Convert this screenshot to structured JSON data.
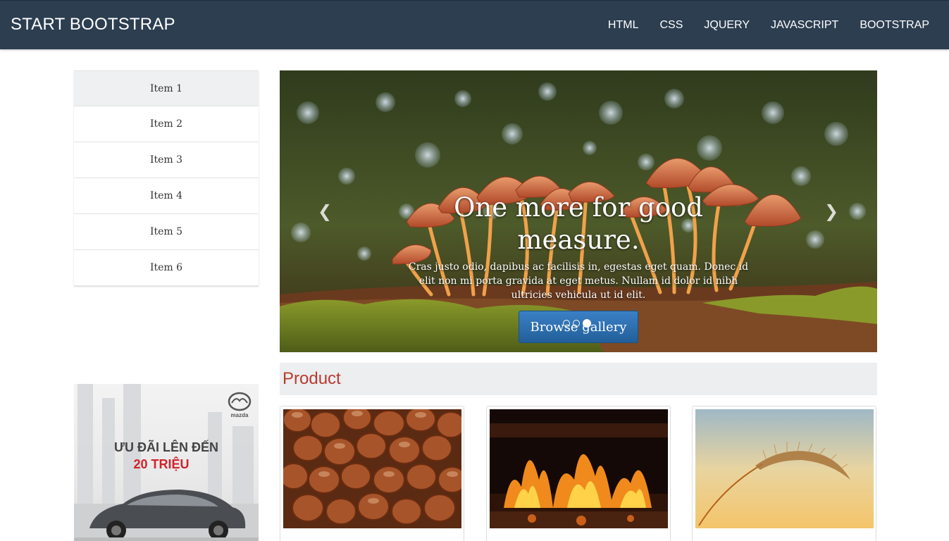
{
  "navbar": {
    "brand": "START BOOTSTRAP",
    "links": [
      "HTML",
      "CSS",
      "JQUERY",
      "JAVASCRIPT",
      "BOOTSTRAP"
    ]
  },
  "sidebar": {
    "items": [
      {
        "label": "Item 1",
        "active": true
      },
      {
        "label": "Item 2"
      },
      {
        "label": "Item 3"
      },
      {
        "label": "Item 4"
      },
      {
        "label": "Item 5"
      },
      {
        "label": "Item 6"
      }
    ]
  },
  "carousel": {
    "heading": "One more for good measure.",
    "text": "Cras justo odio, dapibus ac facilisis in, egestas eget quam. Donec id elit non mi porta gravida at eget metus. Nullam id dolor id nibh ultricies vehicula ut id elit.",
    "button_label": "Browse gallery",
    "prev_icon": "chevron-left-icon",
    "next_icon": "chevron-right-icon",
    "slide_count": 3,
    "active_slide": 3
  },
  "product": {
    "title": "Product",
    "cards": [
      {
        "image": "hazelnuts-photo"
      },
      {
        "image": "fireplace-photo"
      },
      {
        "image": "grass-sunset-photo"
      }
    ]
  },
  "ad": {
    "brand": "mazda",
    "line1": "ƯU ĐÃI LÊN ĐẾN",
    "line2": "20 TRIỆU"
  },
  "colors": {
    "navbar_bg": "#2c3e50",
    "product_title": "#b83b2f",
    "button": "#2a6aa8",
    "sidebar_active": "#eef0f1"
  }
}
